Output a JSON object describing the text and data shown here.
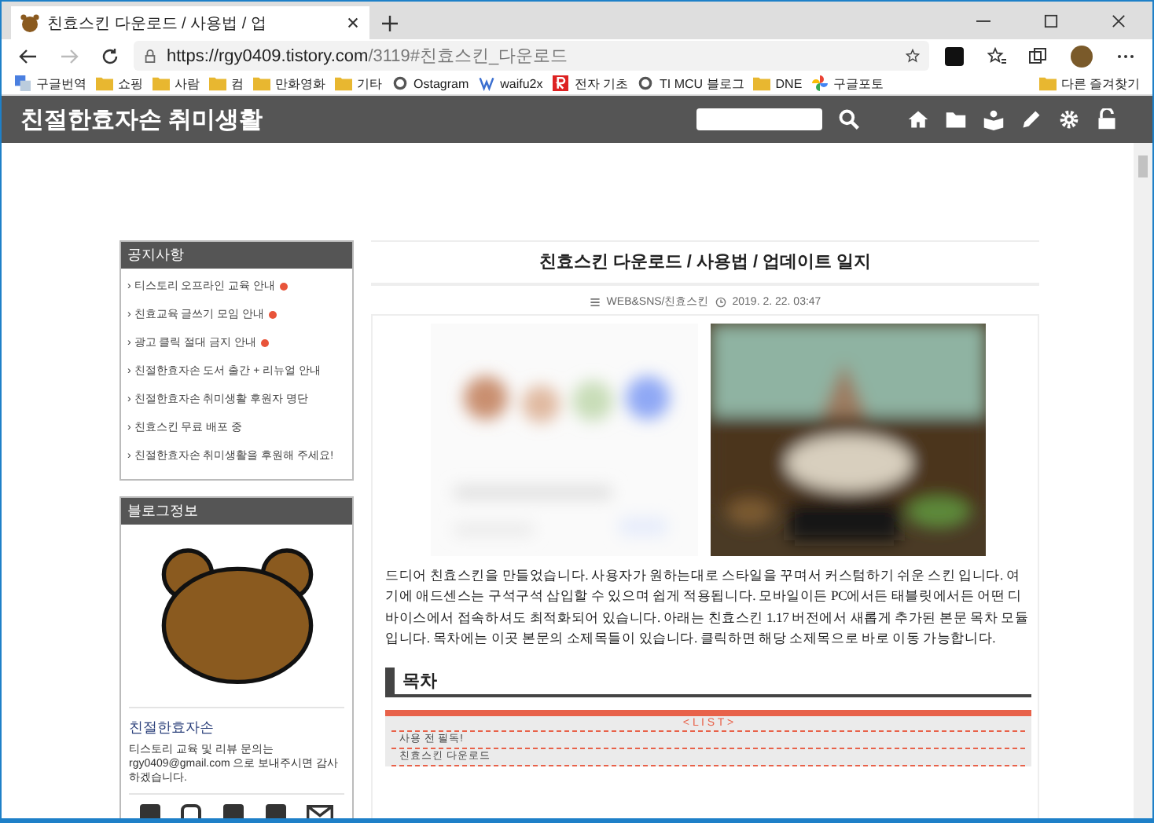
{
  "browser": {
    "tab_title": "친효스킨 다운로드 / 사용법 / 업",
    "url_host": "https://rgy0409.tistory.com",
    "url_path": "/3119#친효스킨_다운로드",
    "bookmarks": [
      {
        "label": "구글번역",
        "kind": "translate"
      },
      {
        "label": "쇼핑",
        "kind": "folder"
      },
      {
        "label": "사람",
        "kind": "folder"
      },
      {
        "label": "컴",
        "kind": "folder"
      },
      {
        "label": "만화영화",
        "kind": "folder"
      },
      {
        "label": "기타",
        "kind": "folder"
      },
      {
        "label": "Ostagram",
        "kind": "site"
      },
      {
        "label": "waifu2x",
        "kind": "w"
      },
      {
        "label": "전자 기초",
        "kind": "r"
      },
      {
        "label": "TI MCU 블로그",
        "kind": "site"
      },
      {
        "label": "DNE",
        "kind": "folder"
      },
      {
        "label": "구글포토",
        "kind": "photos"
      }
    ],
    "other_bookmarks": "다른 즐겨찾기"
  },
  "blog": {
    "title": "친절한효자손 취미생활"
  },
  "notices": {
    "title": "공지사항",
    "items": [
      {
        "text": "› 티스토리 오프라인 교육 안내",
        "new": true
      },
      {
        "text": "› 친효교육 글쓰기 모임 안내",
        "new": true
      },
      {
        "text": "› 광고 클릭 절대 금지 안내",
        "new": true
      },
      {
        "text": "› 친절한효자손 도서 출간 + 리뉴얼 안내",
        "new": false
      },
      {
        "text": "› 친절한효자손 취미생활 후원자 명단",
        "new": false
      },
      {
        "text": "› 친효스킨 무료 배포 중",
        "new": false
      },
      {
        "text": "› 친절한효자손 취미생활을 후원해 주세요!",
        "new": false
      }
    ]
  },
  "profile": {
    "title": "블로그정보",
    "name": "친절한효자손",
    "description": "티스토리 교육 및 리뷰 문의는 rgy0409@gmail.com 으로 보내주시면 감사하겠습니다."
  },
  "post": {
    "title": "친효스킨 다운로드 / 사용법 / 업데이트 일지",
    "category": "WEB&SNS/친효스킨",
    "date": "2019. 2. 22. 03:47",
    "body": "드디어 친효스킨을 만들었습니다. 사용자가 원하는대로 스타일을 꾸며서 커스텀하기 쉬운 스킨 입니다. 여기에 애드센스는 구석구석 삽입할 수 있으며 쉽게 적용됩니다. 모바일이든 PC에서든 태블릿에서든 어떤 디바이스에서 접속하셔도 최적화되어 있습니다. 아래는 친효스킨 1.17 버전에서 새롭게 추가된 본문 목차 모듈 입니다. 목차에는 이곳 본문의 소제목들이 있습니다. 클릭하면 해당 소제목으로 바로 이동 가능합니다.",
    "toc_heading": "목차",
    "toc_label": "< L I S T >",
    "toc_items": [
      "사용 전 필독!",
      "친효스킨 다운로드"
    ]
  }
}
